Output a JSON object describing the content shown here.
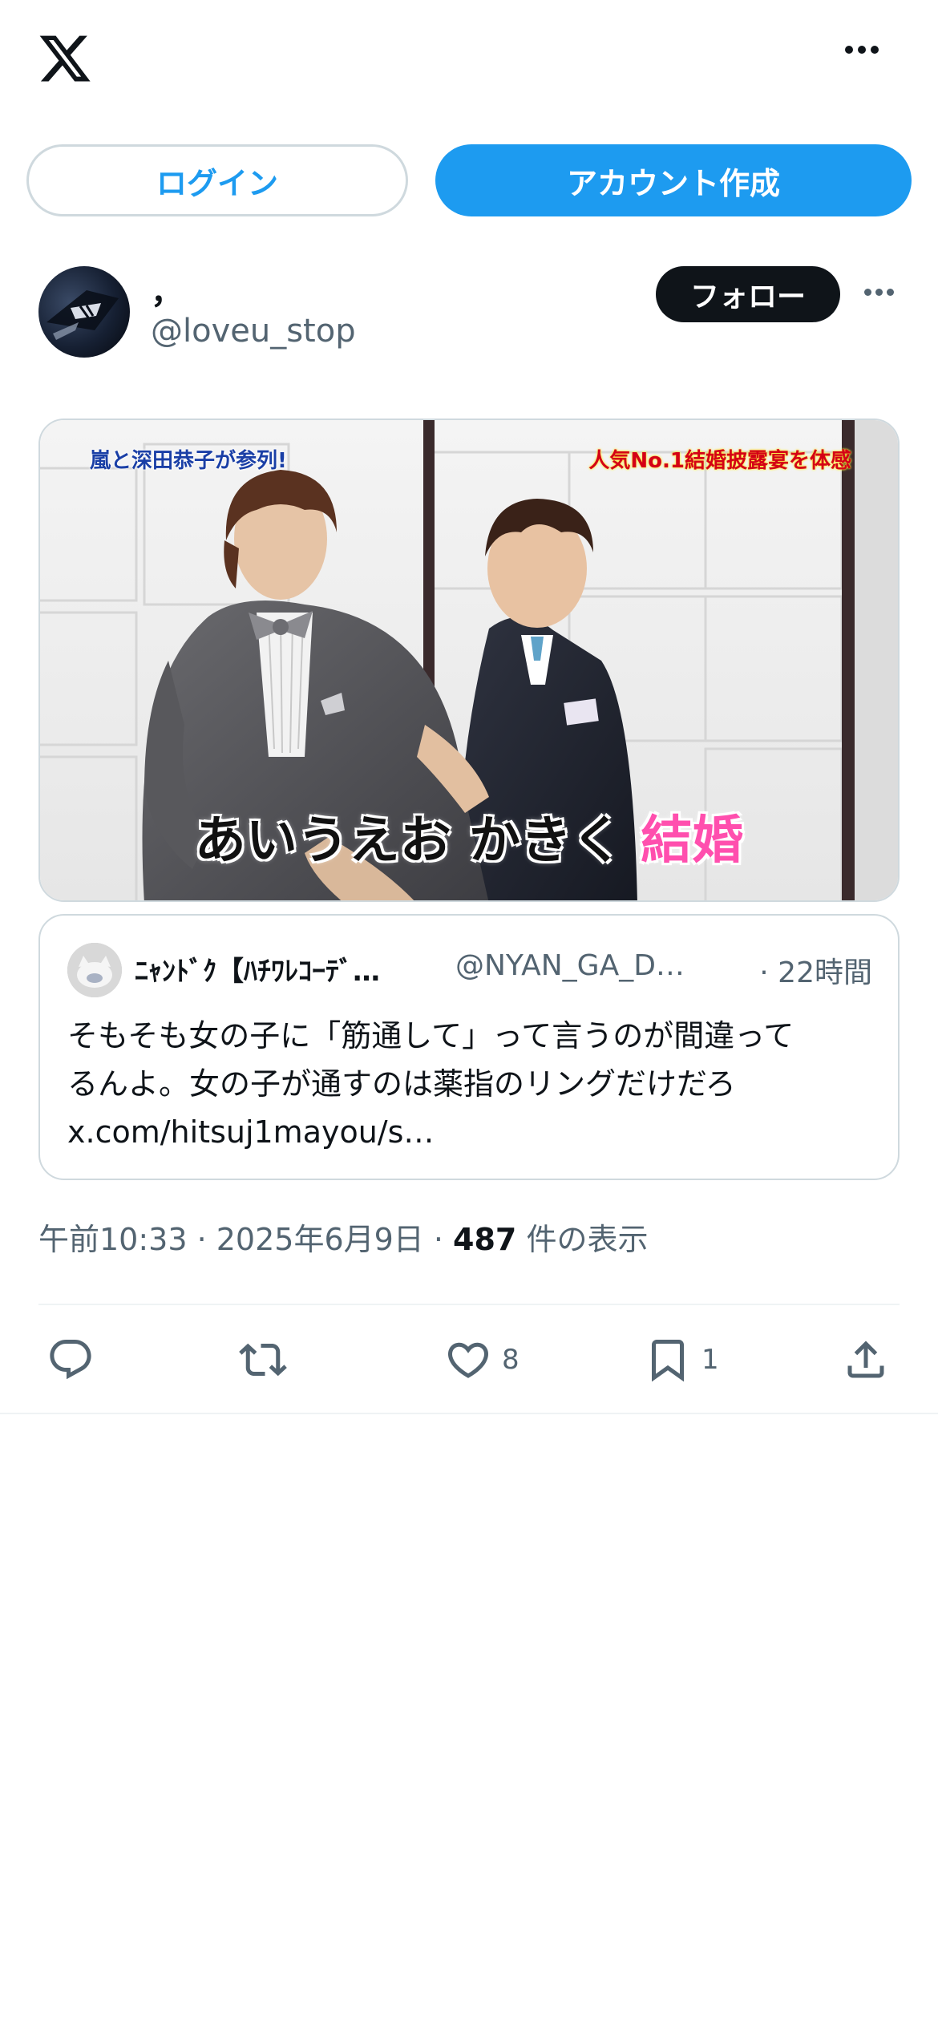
{
  "header": {
    "logo_icon": "x-logo-icon",
    "more_icon": "more-dots-icon"
  },
  "auth": {
    "login_label": "ログイン",
    "signup_label": "アカウント作成"
  },
  "post": {
    "author": {
      "display_name": "，",
      "handle": "@loveu_stop"
    },
    "follow_label": "フォロー",
    "media": {
      "caption_left": "嵐と深田恭子が参列!",
      "caption_right": "人気No.1結婚披露宴を体感",
      "subtitle_main": "あいうえお かきく ",
      "subtitle_highlight": "結婚"
    },
    "quote": {
      "display_name": "ﾆｬﾝﾄﾞｸ【ﾊﾁﾜﾚｺｰﾃﾞ…",
      "handle": "@NYAN_GA_D…",
      "time": "· 22時間",
      "text_line1": "そもそも女の子に「筋通して」って言うのが間違って",
      "text_line2": "るんよ。女の子が通すのは薬指のリングだけだろ",
      "link": "x.com/hitsuj1mayou/s…"
    },
    "timestamp": {
      "time_date": "午前10:33 · 2025年6月9日 · ",
      "views_count": "487",
      "views_label": " 件の表示"
    },
    "actions": {
      "reply_icon": "reply-icon",
      "retweet_icon": "retweet-icon",
      "like_icon": "heart-icon",
      "like_count": "8",
      "bookmark_icon": "bookmark-icon",
      "bookmark_count": "1",
      "share_icon": "share-icon"
    }
  },
  "colors": {
    "accent": "#1d9bf0",
    "text": "#0f1419",
    "muted": "#536471",
    "border": "#cfd9de"
  }
}
